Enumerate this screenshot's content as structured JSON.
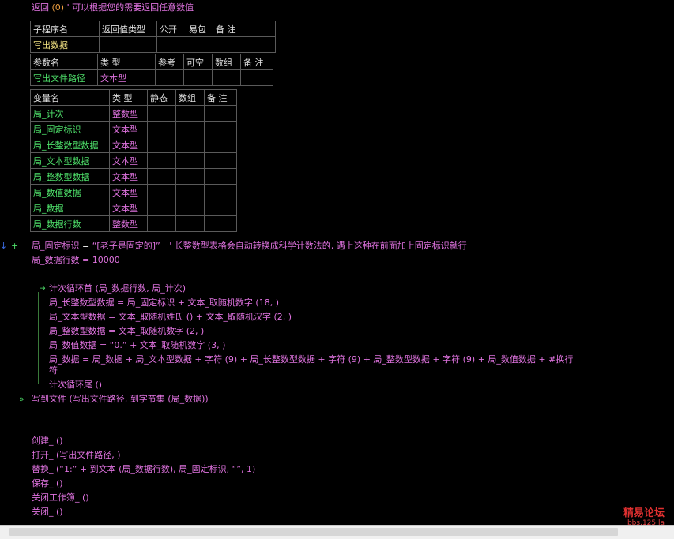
{
  "return_line": {
    "keyword": "返回",
    "arg": "(0)",
    "comment": "' 可以根据您的需要返回任意数值"
  },
  "sub_table": {
    "headers": [
      "子程序名",
      "返回值类型",
      "公开",
      "易包",
      "备 注"
    ],
    "row": [
      "写出数据",
      "",
      "",
      "",
      ""
    ]
  },
  "param_table": {
    "headers": [
      "参数名",
      "类 型",
      "参考",
      "可空",
      "数组",
      "备 注"
    ],
    "row": [
      "写出文件路径",
      "文本型",
      "",
      "",
      "",
      ""
    ]
  },
  "var_table": {
    "headers": [
      "变量名",
      "类 型",
      "静态",
      "数组",
      "备 注"
    ],
    "rows": [
      [
        "局_计次",
        "整数型"
      ],
      [
        "局_固定标识",
        "文本型"
      ],
      [
        "局_长整数型数据",
        "文本型"
      ],
      [
        "局_文本型数据",
        "文本型"
      ],
      [
        "局_整数型数据",
        "文本型"
      ],
      [
        "局_数值数据",
        "文本型"
      ],
      [
        "局_数据",
        "文本型"
      ],
      [
        "局_数据行数",
        "整数型"
      ]
    ]
  },
  "code": {
    "l1_var": "局_固定标识",
    "l1_op": "=",
    "l1_val": "“[老子是固定的]”",
    "l1_comment": "' 长整数型表格会自动转换成科学计数法的, 遇上这种在前面加上固定标识就行",
    "l2": "局_数据行数 = 10000",
    "loop_head": "计次循环首 (局_数据行数, 局_计次)",
    "loop_l1": "局_长整数型数据 = 局_固定标识 + 文本_取随机数字 (18, )",
    "loop_l2": "局_文本型数据 = 文本_取随机姓氏 () + 文本_取随机汉字 (2, )",
    "loop_l3": "局_整数型数据 = 文本_取随机数字 (2, )",
    "loop_l4": "局_数值数据 = “0.” + 文本_取随机数字 (3, )",
    "loop_l5a": "局_数据 = 局_数据 + 局_文本型数据 + 字符 (9) + 局_长整数型数据 + 字符 (9) + 局_整数型数据 + 字符 (9) + 局_数值数据 + #换行",
    "loop_l5b": "符",
    "loop_tail": "计次循环尾 ()",
    "write": "写到文件 (写出文件路径, 到字节集 (局_数据))",
    "c1": "创建_ ()",
    "c2": "打开_ (写出文件路径, )",
    "c3": "替换_ (“1:” + 到文本 (局_数据行数), 局_固定标识, “”, 1)",
    "c4": "保存_ ()",
    "c5": "关闭工作簿_ ()",
    "c6": "关闭_ ()"
  },
  "markers": {
    "plus": "+",
    "arrow": "↓",
    "chevron": "»",
    "loop_arrow": "→"
  },
  "watermark": {
    "line1": "精易论坛",
    "line2": "bbs.125.la"
  },
  "colors": {
    "background": "#000000",
    "keyword": "#e073e0",
    "type": "#e073e0",
    "name": "#4ee06a",
    "header": "#e0e0e0",
    "comment": "#e073e0"
  }
}
